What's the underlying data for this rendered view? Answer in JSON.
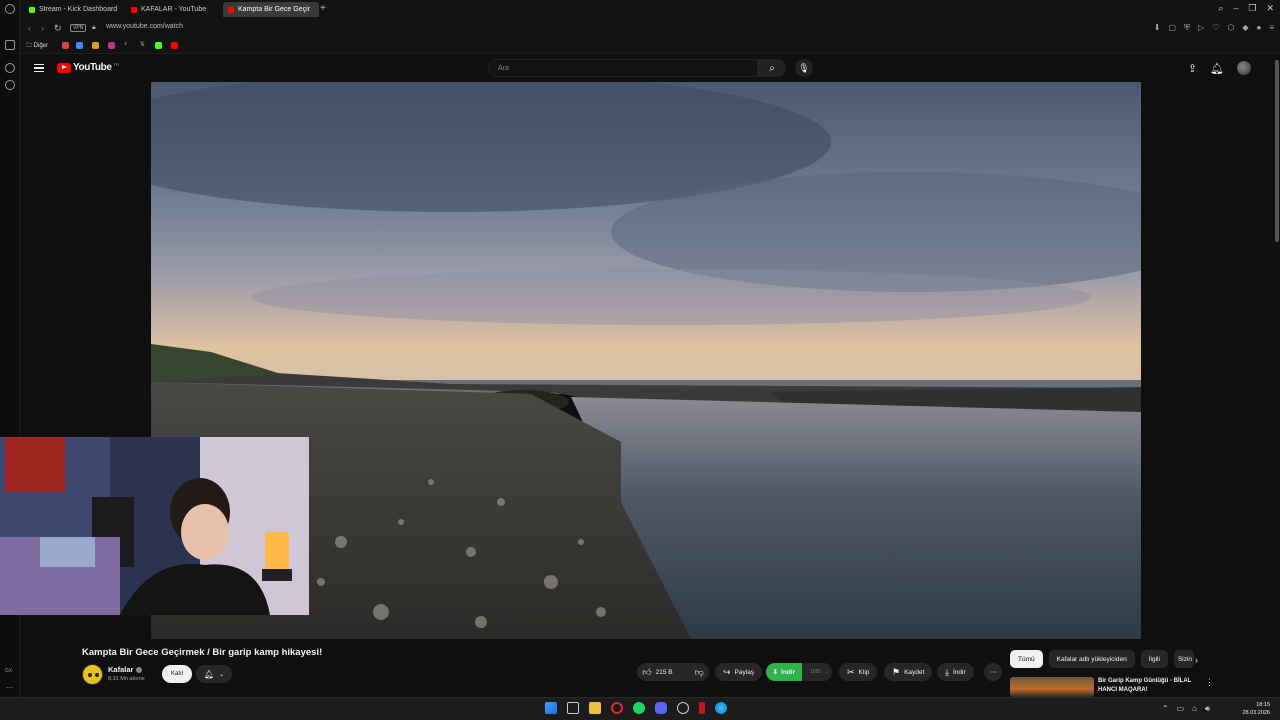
{
  "browser": {
    "tabs": [
      {
        "label": "Stream - Kick Dashboard",
        "favicon_color": "#53fc18"
      },
      {
        "label": "KAFALAR - YouTube",
        "favicon_color": "#ff0000"
      },
      {
        "label": "Kampta Bir Gece Geçir",
        "favicon_color": "#ff0000"
      }
    ],
    "url": "www.youtube.com/watch",
    "vpn_label": "VPN",
    "bookmarks_label": "Diğer"
  },
  "youtube": {
    "logo_text": "YouTube",
    "country_code": "TR",
    "search_placeholder": "Ara"
  },
  "video": {
    "title": "Kampta Bir Gece Geçirmek / Bir garip kamp hikayesi!",
    "channel_name": "Kafalar",
    "subscribers": "8,31 Mn abone",
    "join_label": "Katıl",
    "likes": "215 B",
    "share_label": "Paylaş",
    "download_ext_label": "İndir",
    "download_ext_quality": "1080",
    "clip_label": "Klip",
    "save_label": "Kaydet",
    "download_label": "İndir"
  },
  "sidebar": {
    "chips": [
      "Tümü",
      "Kafalar adlı yükleyiciden",
      "İlgili",
      "Sizin"
    ],
    "recommended": [
      {
        "title": "Bir Garip Kamp Günlüğü - BİLAL HANCI MAQARA!"
      }
    ]
  },
  "taskbar": {
    "left_label": "GX",
    "time": "18:15",
    "date": "28.03.2026"
  }
}
